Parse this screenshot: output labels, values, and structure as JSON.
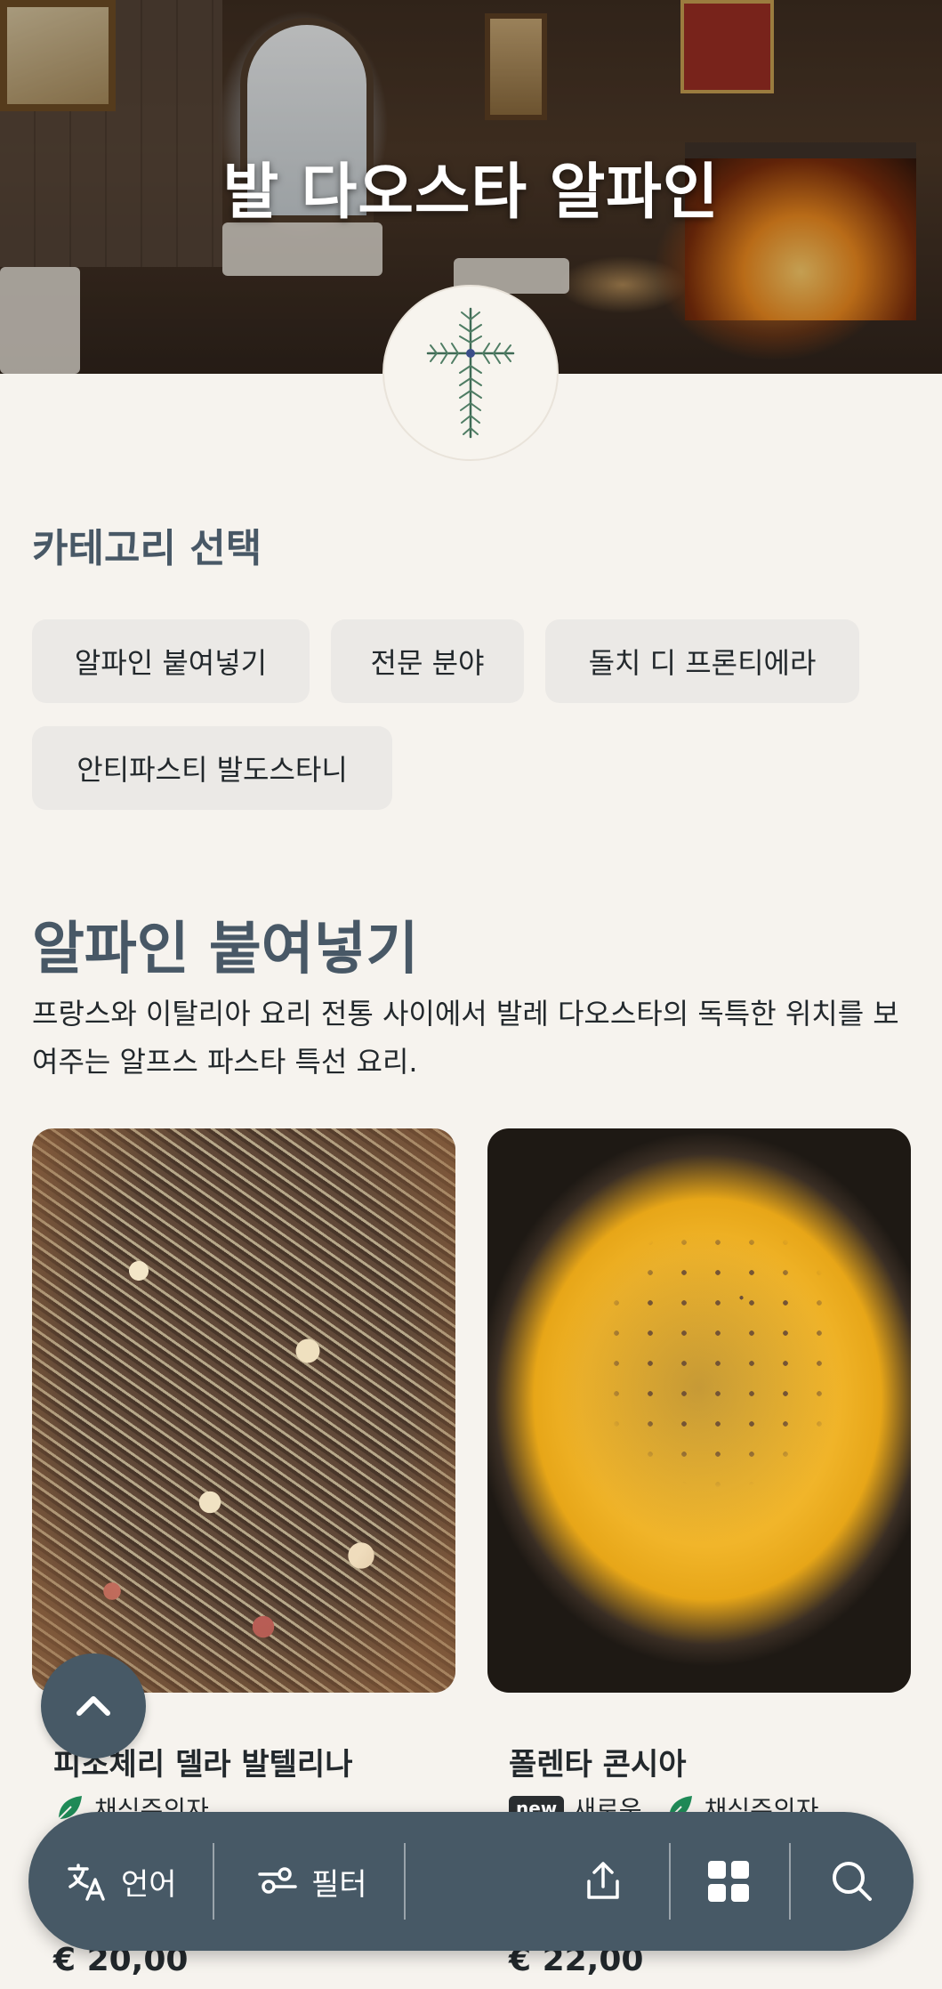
{
  "header": {
    "restaurant_name": "발 다오스타 알파인"
  },
  "categories": {
    "title": "카테고리 선택",
    "items": [
      {
        "label": "알파인 붙여넣기"
      },
      {
        "label": "전문 분야"
      },
      {
        "label": "돌치 디 프론티에라"
      },
      {
        "label": "안티파스티 발도스타니"
      }
    ]
  },
  "section": {
    "title": "알파인 붙여넣기",
    "description": "프랑스와 이탈리아 요리 전통 사이에서 발레 다오스타의 독특한 위치를 보여주는 알프스 파스타 특선 요리."
  },
  "dishes": [
    {
      "name": "피조체리 델라 발텔리나",
      "tags": [
        {
          "type": "vegetarian",
          "label": "채식주의자"
        }
      ],
      "price": "€ 20,00"
    },
    {
      "name": "폴렌타 콘시아",
      "tags": [
        {
          "type": "new",
          "badge": "new",
          "label": "새로운"
        },
        {
          "type": "vegetarian",
          "label": "채식주의자"
        }
      ],
      "price": "€ 22,00"
    }
  ],
  "bottom_bar": {
    "language_label": "언어",
    "filter_label": "필터"
  },
  "icons": {
    "scroll_top": "chevron-up-icon",
    "language": "translate-icon",
    "filter": "filter-icon",
    "share": "share-icon",
    "grid": "grid-icon",
    "search": "search-icon",
    "vegetarian": "leaf-icon",
    "logo": "cross-herb-logo"
  },
  "colors": {
    "accent": "#475966",
    "background": "#f6f3ee",
    "chip": "#ebe9e6",
    "vegetarian": "#1f8a57"
  }
}
